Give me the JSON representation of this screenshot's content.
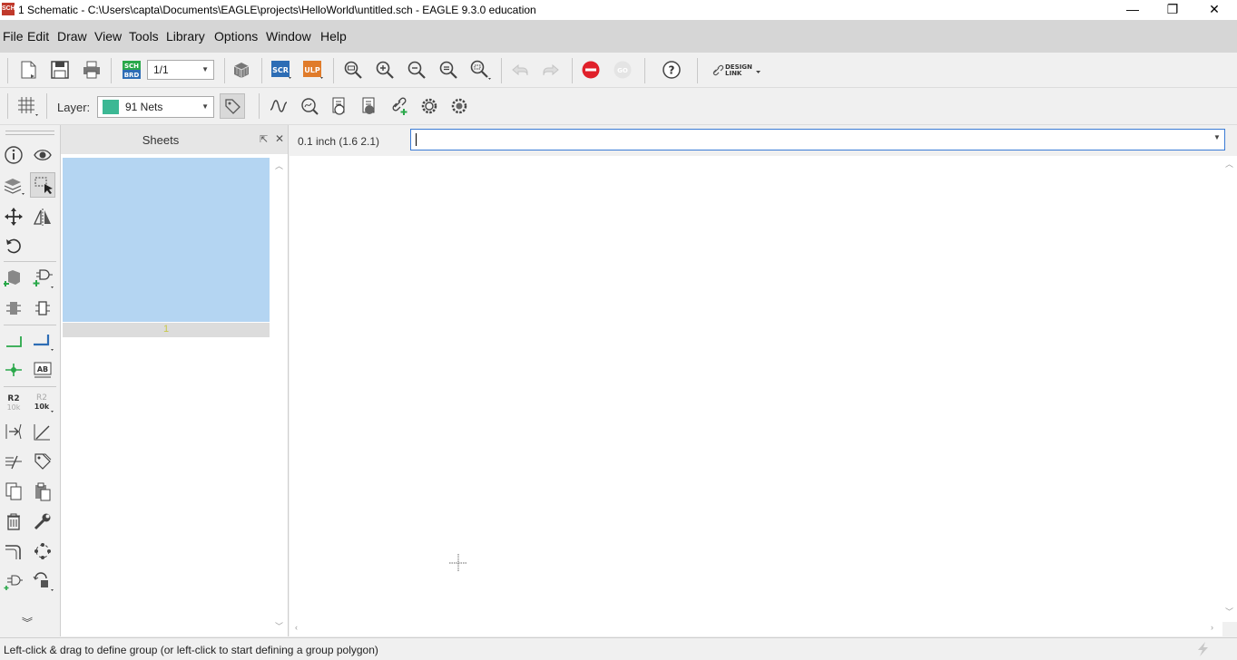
{
  "window": {
    "title": "1 Schematic - C:\\Users\\capta\\Documents\\EAGLE\\projects\\HelloWorld\\untitled.sch - EAGLE 9.3.0 education",
    "app_icon_text": "SCH",
    "minimize": "—",
    "restore": "❐",
    "close": "✕"
  },
  "menu": [
    "File",
    "Edit",
    "Draw",
    "View",
    "Tools",
    "Library",
    "Options",
    "Window",
    "Help"
  ],
  "toolbar": {
    "sheet_select": "1/1",
    "scr_label": "SCR",
    "ulp_label": "ULP",
    "sch_label": "SCH",
    "brd_label": "BRD",
    "go_label": "GO",
    "help_label": "?",
    "design_link_label": "DESIGN",
    "design_link_label2": "LINK"
  },
  "layer_bar": {
    "layer_label": "Layer:",
    "layer_value": "91 Nets",
    "layer_color": "#3cb894"
  },
  "left_tools": {
    "value_label_r2": "R2",
    "value_label_10k": "10k",
    "text_tool_label": "AB"
  },
  "sheets_panel": {
    "title": "Sheets",
    "sheet_number": "1"
  },
  "coords": {
    "grid_readout": "0.1 inch (1.6 2.1)"
  },
  "command_line": {
    "value": ""
  },
  "status": {
    "text": "Left-click & drag to define group (or left-click to start defining a group polygon)"
  },
  "colors": {
    "accent_blue": "#3a7bd5",
    "sheet_selected": "#b4d5f2",
    "stop_red": "#e0202a",
    "scr_blue": "#2d6db5",
    "ulp_orange": "#e07b2a",
    "green": "#2aa84a"
  }
}
